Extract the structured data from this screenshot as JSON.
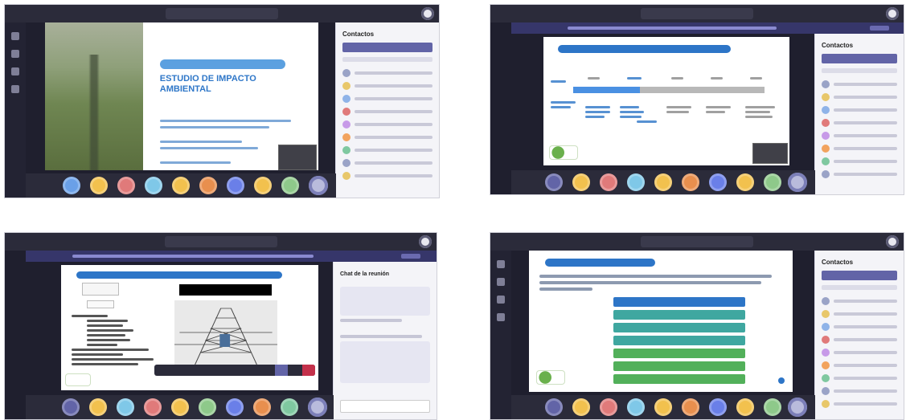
{
  "panels": [
    {
      "id": "top-left",
      "window_title": "",
      "slide_title": "ESTUDIO DE IMPACTO AMBIENTAL",
      "right_panel_title": "Contactos",
      "avatar_colors": [
        "#6aa0e8",
        "#f2c14e",
        "#e07a7a",
        "#7fc8e8",
        "#f2c14e",
        "#e88f4e",
        "#6a7fe8",
        "#f2c14e",
        "#8ec98a"
      ],
      "participant_colors": [
        "#9aa3c7",
        "#e8c76a",
        "#8fb3e8",
        "#e07a7a",
        "#c79ae8",
        "#f2a35e",
        "#7fc8a0",
        "#9aa3c7",
        "#e8c76a"
      ]
    },
    {
      "id": "top-right",
      "window_title": "",
      "right_panel_title": "Contactos",
      "avatar_colors": [
        "#6264a7",
        "#f2c14e",
        "#e07a7a",
        "#7fc8e8",
        "#f2c14e",
        "#e88f4e",
        "#6a7fe8",
        "#f2c14e",
        "#8ec98a"
      ],
      "participant_colors": [
        "#9aa3c7",
        "#e8c76a",
        "#8fb3e8",
        "#e07a7a",
        "#c79ae8",
        "#f2a35e",
        "#7fc8a0",
        "#9aa3c7"
      ]
    },
    {
      "id": "bottom-left",
      "window_title": "",
      "chat_title": "Chat de la reunión",
      "avatar_colors": [
        "#6264a7",
        "#f2c14e",
        "#7fc8e8",
        "#e07a7a",
        "#f2c14e",
        "#8ec98a",
        "#6a7fe8",
        "#e88f4e",
        "#7fc8a0"
      ]
    },
    {
      "id": "bottom-right",
      "window_title": "",
      "right_panel_title": "Contactos",
      "avatar_colors": [
        "#6264a7",
        "#f2c14e",
        "#e07a7a",
        "#7fc8e8",
        "#f2c14e",
        "#e88f4e",
        "#6a7fe8",
        "#f2c14e",
        "#8ec98a"
      ],
      "participant_colors": [
        "#9aa3c7",
        "#e8c76a",
        "#8fb3e8",
        "#e07a7a",
        "#c79ae8",
        "#f2a35e",
        "#7fc8a0",
        "#9aa3c7",
        "#e8c76a"
      ],
      "bar_colors": [
        "#2d75c7",
        "#3fa7a0",
        "#3fa7a0",
        "#3fa7a0",
        "#52b05a",
        "#52b05a",
        "#52b05a"
      ]
    }
  ]
}
